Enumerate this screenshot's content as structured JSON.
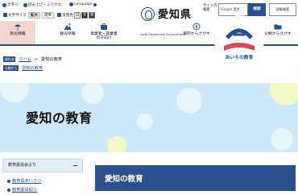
{
  "util": {
    "text_mode": "文字へ",
    "read_aloud": "読み上げ・ふりがな",
    "language": "Language"
  },
  "accessibility": {
    "font_size_label": "文字サイズ",
    "enlarge": "拡大",
    "standard": "標準",
    "bg_color_label": "背景色",
    "swatches": [
      "白",
      "黒",
      "青"
    ]
  },
  "header": {
    "logo_text": "愛知県",
    "logo_sub": "Aichi Prefectural Government"
  },
  "search": {
    "label": "サイト内検索",
    "placeholder": "Google 提供",
    "button": "検索",
    "advanced": "詳細検索"
  },
  "nav": {
    "items": [
      {
        "label": "防災情報",
        "icon": "umbrella-icon"
      },
      {
        "label": "観光情報",
        "icon": "mountain-icon"
      },
      {
        "label": "事業者・就業者の方向け",
        "icon": "briefcase-icon"
      },
      {
        "label": "目的からさがす",
        "icon": "compass-icon"
      },
      {
        "label": "組織からさがす",
        "icon": "organization-icon"
      },
      {
        "label": "分類からさがす",
        "icon": "folder-icon"
      }
    ]
  },
  "breadcrumb": {
    "tag1": "現在地",
    "home": "ホーム",
    "sep": ">",
    "current1": "愛知の教育",
    "tag2": "分類から",
    "current2": "愛知の教育"
  },
  "banner": {
    "title": "愛知の教育",
    "logo_text": "あいちの教育"
  },
  "sidebar": {
    "heading": "教育委員会より",
    "links": [
      "教育長あいさつ",
      "教育委員紹介"
    ]
  },
  "main": {
    "heading": "愛知の教育"
  },
  "colors": {
    "primary": "#2b4f8c",
    "banner_bg": "#cfe7f7",
    "nav_active_bg": "#f1d6cf"
  }
}
